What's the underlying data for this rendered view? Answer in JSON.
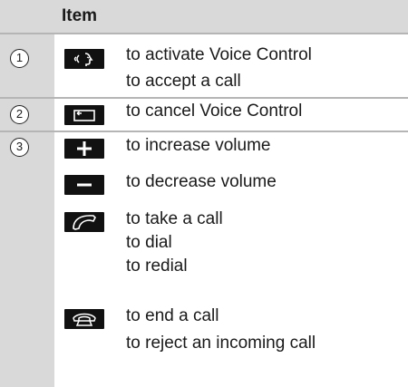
{
  "header": {
    "item_label": "Item"
  },
  "rows": [
    {
      "number": "1",
      "entries": [
        {
          "icon": "voice-control-icon",
          "lines": [
            "to activate Voice Control",
            "to accept a call"
          ]
        }
      ]
    },
    {
      "number": "2",
      "entries": [
        {
          "icon": "back-icon",
          "lines": [
            "to cancel Voice Control"
          ]
        }
      ]
    },
    {
      "number": "3",
      "entries": [
        {
          "icon": "plus-icon",
          "lines": [
            "to increase volume"
          ]
        },
        {
          "icon": "minus-icon",
          "lines": [
            "to decrease volume"
          ]
        },
        {
          "icon": "phone-pickup-icon",
          "lines": [
            "to take a call",
            "to dial",
            "to redial"
          ]
        },
        {
          "icon": "phone-hangup-icon",
          "lines": [
            "to end a call",
            "to reject an incoming call"
          ]
        }
      ]
    }
  ]
}
